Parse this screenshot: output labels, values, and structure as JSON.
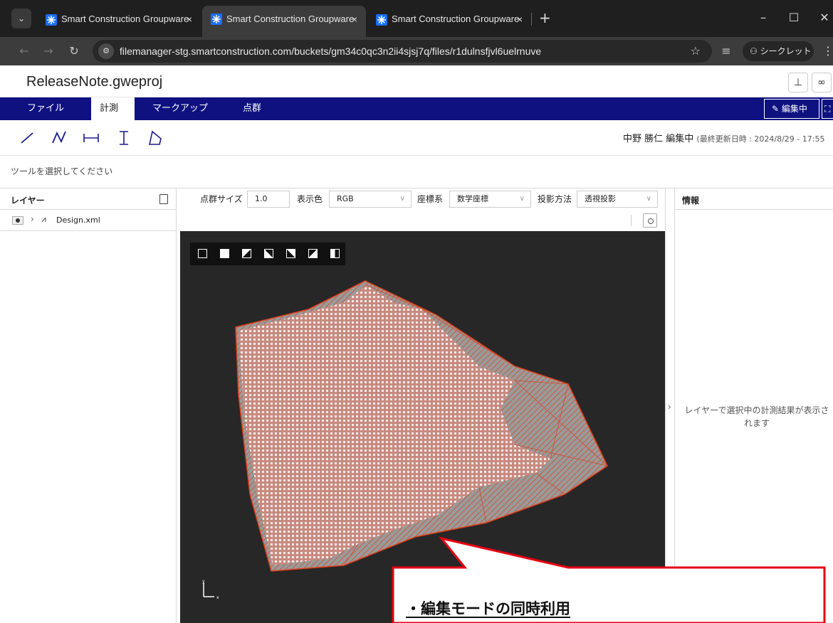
{
  "browser": {
    "tabs": [
      {
        "label": "Smart Construction Groupware"
      },
      {
        "label": "Smart Construction Groupware"
      },
      {
        "label": "Smart Construction Groupware"
      }
    ],
    "close_glyph": "×",
    "new_tab_glyph": "+",
    "url": "filemanager-stg.smartconstruction.com/buckets/gm34c0qc3n2ii4sjsj7q/files/r1dulnsfjvl6uelrnuve",
    "incognito_label": "シークレット",
    "brand_color": "#1b6ef3"
  },
  "app": {
    "title": "ReleaseNote.gweproj",
    "menu": [
      {
        "label": "ファイル"
      },
      {
        "label": "計測"
      },
      {
        "label": "マークアップ"
      },
      {
        "label": "点群"
      }
    ],
    "edit_button": "編集中",
    "editor_name": "中野 勝仁 編集中",
    "last_updated": "(最終更新日時 : 2024/8/29 - 17:55",
    "hint": "ツールを選択してください",
    "menubar_color": "#0e117f"
  },
  "layers": {
    "title": "レイヤー",
    "items": [
      {
        "name": "Design.xml"
      }
    ]
  },
  "viewer": {
    "point_size_label": "点群サイズ",
    "point_size_value": "1.0",
    "color_label": "表示色",
    "color_value": "RGB",
    "coord_label": "座標系",
    "coord_value": "数学座標",
    "projection_label": "投影方法",
    "projection_value": "透視投影",
    "axis_x": "x",
    "axis_y": "y"
  },
  "info": {
    "title": "情報",
    "message": "レイヤーで選択中の計測結果が表示されます"
  },
  "callout": {
    "text": "・編集モードの同時利用",
    "border_color": "#e60012"
  }
}
